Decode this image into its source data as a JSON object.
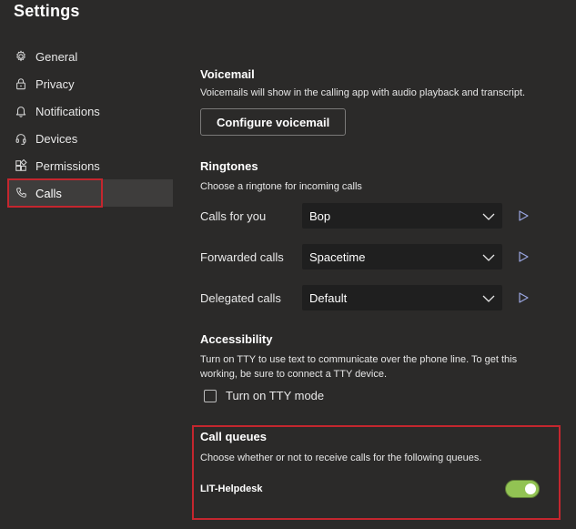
{
  "window": {
    "title": "Settings"
  },
  "sidebar": {
    "items": [
      {
        "label": "General",
        "icon": "gear-icon"
      },
      {
        "label": "Privacy",
        "icon": "lock-icon"
      },
      {
        "label": "Notifications",
        "icon": "bell-icon"
      },
      {
        "label": "Devices",
        "icon": "headset-icon"
      },
      {
        "label": "Permissions",
        "icon": "apps-icon"
      },
      {
        "label": "Calls",
        "icon": "phone-icon",
        "active": true
      }
    ]
  },
  "voicemail": {
    "heading": "Voicemail",
    "description": "Voicemails will show in the calling app with audio playback and transcript.",
    "button_label": "Configure voicemail"
  },
  "ringtones": {
    "heading": "Ringtones",
    "description": "Choose a ringtone for incoming calls",
    "rows": [
      {
        "label": "Calls for you",
        "value": "Bop"
      },
      {
        "label": "Forwarded calls",
        "value": "Spacetime"
      },
      {
        "label": "Delegated calls",
        "value": "Default"
      }
    ]
  },
  "accessibility": {
    "heading": "Accessibility",
    "description_line1": "Turn on TTY to use text to communicate over the phone line. To get this",
    "description_line2": "working, be sure to connect a TTY device.",
    "checkbox_label": "Turn on TTY mode",
    "checked": false
  },
  "call_queues": {
    "heading": "Call queues",
    "description": "Choose whether or not to receive calls for the following queues.",
    "queues": [
      {
        "name": "LIT-Helpdesk",
        "enabled": true
      }
    ]
  },
  "colors": {
    "background": "#2b2a29",
    "highlight_border": "#c4262e",
    "toggle_on": "#92c353"
  }
}
